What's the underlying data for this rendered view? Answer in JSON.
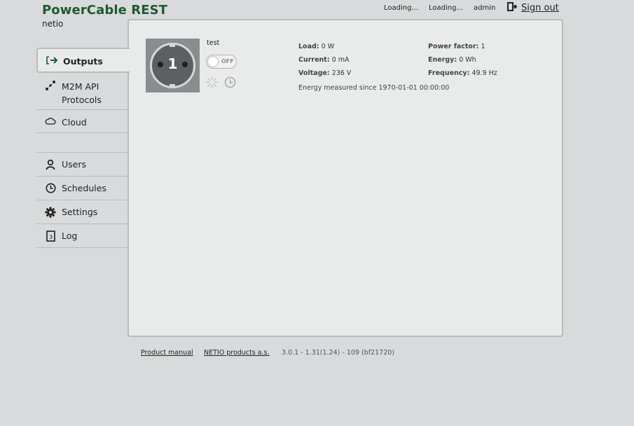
{
  "header": {
    "title": "PowerCable REST",
    "subtitle": "netio",
    "status1": "Loading...",
    "status2": "Loading...",
    "user": "admin",
    "signout_label": "Sign out"
  },
  "nav": {
    "items": [
      {
        "label": "Outputs",
        "icon": "arrow-right-icon"
      },
      {
        "label": "M2M API Protocols",
        "icon": "m2m-icon"
      },
      {
        "label": "Cloud",
        "icon": "cloud-icon"
      },
      {
        "label": "Users",
        "icon": "user-icon"
      },
      {
        "label": "Schedules",
        "icon": "clock-icon"
      },
      {
        "label": "Settings",
        "icon": "gear-icon"
      },
      {
        "label": "Log",
        "icon": "log-icon"
      }
    ]
  },
  "output": {
    "number": "1",
    "name": "test",
    "state": "OFF"
  },
  "measurements": {
    "load_label": "Load:",
    "load_value": "0 W",
    "current_label": "Current:",
    "current_value": "0 mA",
    "voltage_label": "Voltage:",
    "voltage_value": "236 V",
    "pf_label": "Power factor:",
    "pf_value": "1",
    "energy_label": "Energy:",
    "energy_value": "0 Wh",
    "freq_label": "Frequency:",
    "freq_value": "49.9 Hz",
    "since": "Energy measured since 1970-01-01 00:00:00"
  },
  "footer": {
    "manual": "Product manual",
    "company": "NETIO products a.s.",
    "version": "3.0.1 - 1.31(1.24) - 109 (bf21720)"
  },
  "colors": {
    "brand": "#1d5a32",
    "background": "#d9dadb",
    "panel": "#e9eaea"
  }
}
